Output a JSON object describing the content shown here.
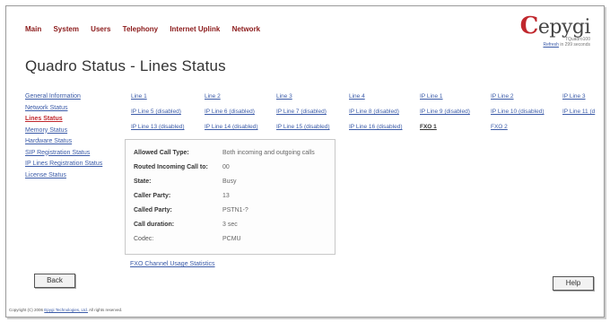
{
  "topnav": [
    "Main",
    "System",
    "Users",
    "Telephony",
    "Internet Uplink",
    "Network"
  ],
  "logo": {
    "brand": "epygi",
    "model": "TQuadro100",
    "refresh_link": "Refresh",
    "refresh_text": "in 299 seconds"
  },
  "page_title": "Quadro Status - Lines Status",
  "sidebar": [
    {
      "label": "General Information",
      "active": false
    },
    {
      "label": "Network Status",
      "active": false
    },
    {
      "label": "Lines Status",
      "active": true
    },
    {
      "label": "Memory Status",
      "active": false
    },
    {
      "label": "Hardware Status",
      "active": false
    },
    {
      "label": "SIP Registration Status",
      "active": false
    },
    {
      "label": "IP Lines Registration Status",
      "active": false
    },
    {
      "label": "License Status",
      "active": false
    }
  ],
  "lines": {
    "row1": [
      "Line 1",
      "Line 2",
      "Line 3",
      "Line 4",
      "IP Line 1",
      "IP Line 2",
      "IP Line 3"
    ],
    "row2": [
      "IP Line 5 (disabled)",
      "IP Line 6 (disabled)",
      "IP Line 7 (disabled)",
      "IP Line 8 (disabled)",
      "IP Line 9 (disabled)",
      "IP Line 10 (disabled)",
      "IP Line 11 (d"
    ],
    "row3": [
      "IP Line 13 (disabled)",
      "IP Line 14 (disabled)",
      "IP Line 15 (disabled)",
      "IP Line 16 (disabled)",
      "FXO 1",
      "FXO 2"
    ]
  },
  "details": [
    {
      "label": "Allowed Call Type:",
      "value": "Both incoming and outgoing calls"
    },
    {
      "label": "Routed Incoming Call to:",
      "value": "00"
    },
    {
      "label": "State:",
      "value": "Busy"
    },
    {
      "label": "Caller Party:",
      "value": "13"
    },
    {
      "label": "Called Party:",
      "value": "PSTN1-?"
    },
    {
      "label": "Call duration:",
      "value": "3 sec"
    },
    {
      "label": "Codec:",
      "value": "PCMU"
    }
  ],
  "fxo_stats_link": "FXO Channel Usage Statistics",
  "buttons": {
    "back": "Back",
    "help": "Help"
  },
  "footer": {
    "prefix": "Copyright (C) 2006",
    "company": "Epygi Technologies, Ltd.",
    "suffix": "All rights reserved."
  }
}
